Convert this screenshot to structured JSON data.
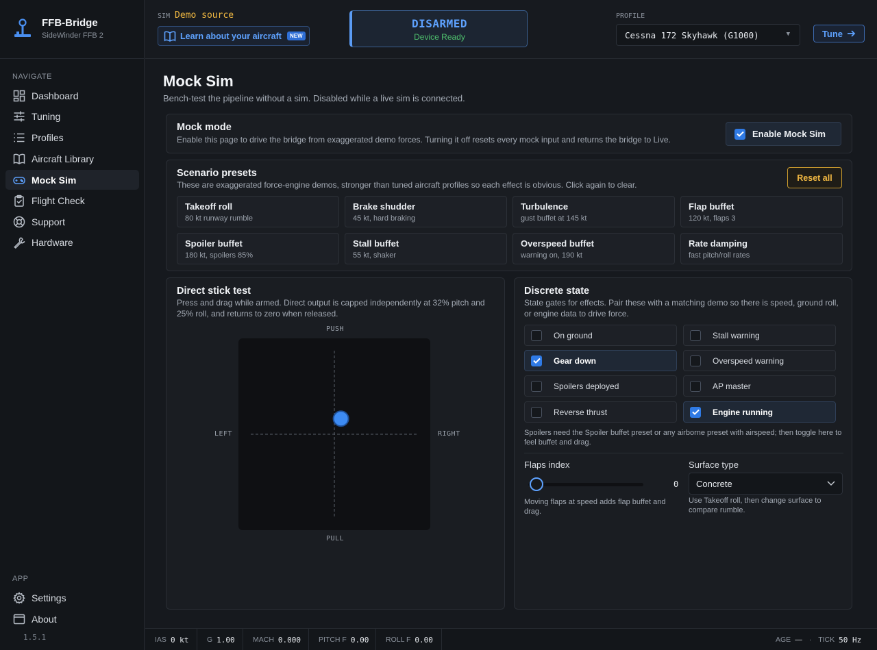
{
  "brand": {
    "name": "FFB-Bridge",
    "device": "SideWinder FFB 2",
    "version": "1.5.1"
  },
  "nav": {
    "heading": "NAVIGATE",
    "items": [
      {
        "label": "Dashboard",
        "icon": "dashboard-icon"
      },
      {
        "label": "Tuning",
        "icon": "sliders-icon"
      },
      {
        "label": "Profiles",
        "icon": "list-icon"
      },
      {
        "label": "Aircraft Library",
        "icon": "book-icon"
      },
      {
        "label": "Mock Sim",
        "icon": "gamepad-icon",
        "active": true
      },
      {
        "label": "Flight Check",
        "icon": "clipboard-check-icon"
      },
      {
        "label": "Support",
        "icon": "lifebuoy-icon"
      },
      {
        "label": "Hardware",
        "icon": "wrench-icon"
      }
    ],
    "app_heading": "APP",
    "app_items": [
      {
        "label": "Settings",
        "icon": "gear-icon"
      },
      {
        "label": "About",
        "icon": "window-icon"
      }
    ]
  },
  "topbar": {
    "sim_label": "SIM",
    "sim_value": "Demo source",
    "learn_label": "Learn about your aircraft",
    "new_badge": "NEW",
    "arm_state": "DISARMED",
    "arm_sub": "Device Ready",
    "profile_label": "PROFILE",
    "profile_value": "Cessna 172 Skyhawk (G1000)",
    "tune_label": "Tune"
  },
  "page": {
    "title": "Mock Sim",
    "subtitle": "Bench-test the pipeline without a sim. Disabled while a live sim is connected."
  },
  "mock_mode": {
    "title": "Mock mode",
    "desc": "Enable this page to drive the bridge from exaggerated demo forces. Turning it off resets every mock input and returns the bridge to Live.",
    "enable_label": "Enable Mock Sim",
    "enabled": true
  },
  "presets": {
    "title": "Scenario presets",
    "desc": "These are exaggerated force-engine demos, stronger than tuned aircraft profiles so each effect is obvious. Click again to clear.",
    "reset_label": "Reset all",
    "items": [
      {
        "name": "Takeoff roll",
        "desc": "80 kt runway rumble"
      },
      {
        "name": "Brake shudder",
        "desc": "45 kt, hard braking"
      },
      {
        "name": "Turbulence",
        "desc": "gust buffet at 145 kt"
      },
      {
        "name": "Flap buffet",
        "desc": "120 kt, flaps 3"
      },
      {
        "name": "Spoiler buffet",
        "desc": "180 kt, spoilers 85%"
      },
      {
        "name": "Stall buffet",
        "desc": "55 kt, shaker"
      },
      {
        "name": "Overspeed buffet",
        "desc": "warning on, 190 kt"
      },
      {
        "name": "Rate damping",
        "desc": "fast pitch/roll rates"
      }
    ]
  },
  "stick": {
    "title": "Direct stick test",
    "desc": "Press and drag while armed. Direct output is capped independently at 32% pitch and 25% roll, and returns to zero when released.",
    "push": "PUSH",
    "pull": "PULL",
    "left": "LEFT",
    "right": "RIGHT",
    "pitch": 0.19,
    "roll": 0.08
  },
  "discrete": {
    "title": "Discrete state",
    "desc": "State gates for effects. Pair these with a matching demo so there is speed, ground roll, or engine data to drive force.",
    "items": [
      {
        "label": "On ground",
        "checked": false
      },
      {
        "label": "Stall warning",
        "checked": false
      },
      {
        "label": "Gear down",
        "checked": true
      },
      {
        "label": "Overspeed warning",
        "checked": false
      },
      {
        "label": "Spoilers deployed",
        "checked": false
      },
      {
        "label": "AP master",
        "checked": false
      },
      {
        "label": "Reverse thrust",
        "checked": false
      },
      {
        "label": "Engine running",
        "checked": true
      }
    ],
    "note": "Spoilers need the Spoiler buffet preset or any airborne preset with airspeed; then toggle here to feel buffet and drag.",
    "flaps_label": "Flaps index",
    "flaps_value": "0",
    "flaps_hint": "Moving flaps at speed adds flap buffet and drag.",
    "surface_label": "Surface type",
    "surface_value": "Concrete",
    "surface_hint": "Use Takeoff roll, then change surface to compare rumble."
  },
  "status": {
    "ias_label": "IAS",
    "ias_value": "0 kt",
    "g_label": "G",
    "g_value": "1.00",
    "mach_label": "MACH",
    "mach_value": "0.000",
    "pitch_label": "PITCH F",
    "pitch_value": "0.00",
    "roll_label": "ROLL F",
    "roll_value": "0.00",
    "age_label": "AGE",
    "age_value": "—",
    "sep": "·",
    "tick_label": "TICK",
    "tick_value": "50 Hz"
  },
  "colors": {
    "accent": "#5ea2ff",
    "warning": "#f2b942",
    "ok": "#4fc36e"
  }
}
